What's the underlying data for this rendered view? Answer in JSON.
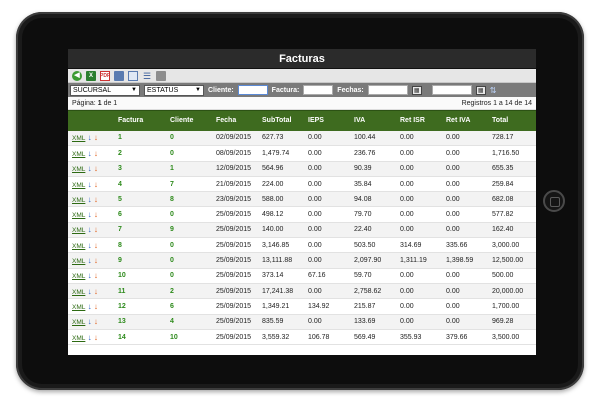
{
  "window": {
    "title": "Facturas"
  },
  "toolbar": {
    "icons": [
      "back-icon",
      "excel-export-icon",
      "pdf-export-icon",
      "print-preview-icon",
      "card-view-icon",
      "list-view-icon",
      "printer-icon"
    ]
  },
  "filters": {
    "sucursal": "SUCURSAL",
    "estatus": "ESTATUS",
    "cliente_label": "Cliente:",
    "cliente_value": "",
    "factura_label": "Factura:",
    "factura_value": "",
    "fechas_label": "Fechas:",
    "fecha_desde": "",
    "fecha_hasta": ""
  },
  "pager": {
    "page_label": "Página:",
    "page_current": "1",
    "page_of": "de 1",
    "records": "Registros 1 a 14 de 14"
  },
  "table": {
    "columns": [
      "",
      "Factura",
      "Cliente",
      "Fecha",
      "SubTotal",
      "IEPS",
      "IVA",
      "Ret ISR",
      "Ret IVA",
      "Total"
    ],
    "xml_label": "XML",
    "rows": [
      {
        "factura": "1",
        "cliente": "0",
        "fecha": "02/09/2015",
        "subtotal": "627.73",
        "ieps": "0.00",
        "iva": "100.44",
        "ret_isr": "0.00",
        "ret_iva": "0.00",
        "total": "728.17"
      },
      {
        "factura": "2",
        "cliente": "0",
        "fecha": "08/09/2015",
        "subtotal": "1,479.74",
        "ieps": "0.00",
        "iva": "236.76",
        "ret_isr": "0.00",
        "ret_iva": "0.00",
        "total": "1,716.50"
      },
      {
        "factura": "3",
        "cliente": "1",
        "fecha": "12/09/2015",
        "subtotal": "564.96",
        "ieps": "0.00",
        "iva": "90.39",
        "ret_isr": "0.00",
        "ret_iva": "0.00",
        "total": "655.35"
      },
      {
        "factura": "4",
        "cliente": "7",
        "fecha": "21/09/2015",
        "subtotal": "224.00",
        "ieps": "0.00",
        "iva": "35.84",
        "ret_isr": "0.00",
        "ret_iva": "0.00",
        "total": "259.84"
      },
      {
        "factura": "5",
        "cliente": "8",
        "fecha": "23/09/2015",
        "subtotal": "588.00",
        "ieps": "0.00",
        "iva": "94.08",
        "ret_isr": "0.00",
        "ret_iva": "0.00",
        "total": "682.08"
      },
      {
        "factura": "6",
        "cliente": "0",
        "fecha": "25/09/2015",
        "subtotal": "498.12",
        "ieps": "0.00",
        "iva": "79.70",
        "ret_isr": "0.00",
        "ret_iva": "0.00",
        "total": "577.82"
      },
      {
        "factura": "7",
        "cliente": "9",
        "fecha": "25/09/2015",
        "subtotal": "140.00",
        "ieps": "0.00",
        "iva": "22.40",
        "ret_isr": "0.00",
        "ret_iva": "0.00",
        "total": "162.40"
      },
      {
        "factura": "8",
        "cliente": "0",
        "fecha": "25/09/2015",
        "subtotal": "3,146.85",
        "ieps": "0.00",
        "iva": "503.50",
        "ret_isr": "314.69",
        "ret_iva": "335.66",
        "total": "3,000.00"
      },
      {
        "factura": "9",
        "cliente": "0",
        "fecha": "25/09/2015",
        "subtotal": "13,111.88",
        "ieps": "0.00",
        "iva": "2,097.90",
        "ret_isr": "1,311.19",
        "ret_iva": "1,398.59",
        "total": "12,500.00"
      },
      {
        "factura": "10",
        "cliente": "0",
        "fecha": "25/09/2015",
        "subtotal": "373.14",
        "ieps": "67.16",
        "iva": "59.70",
        "ret_isr": "0.00",
        "ret_iva": "0.00",
        "total": "500.00"
      },
      {
        "factura": "11",
        "cliente": "2",
        "fecha": "25/09/2015",
        "subtotal": "17,241.38",
        "ieps": "0.00",
        "iva": "2,758.62",
        "ret_isr": "0.00",
        "ret_iva": "0.00",
        "total": "20,000.00"
      },
      {
        "factura": "12",
        "cliente": "6",
        "fecha": "25/09/2015",
        "subtotal": "1,349.21",
        "ieps": "134.92",
        "iva": "215.87",
        "ret_isr": "0.00",
        "ret_iva": "0.00",
        "total": "1,700.00"
      },
      {
        "factura": "13",
        "cliente": "4",
        "fecha": "25/09/2015",
        "subtotal": "835.59",
        "ieps": "0.00",
        "iva": "133.69",
        "ret_isr": "0.00",
        "ret_iva": "0.00",
        "total": "969.28"
      },
      {
        "factura": "14",
        "cliente": "10",
        "fecha": "25/09/2015",
        "subtotal": "3,559.32",
        "ieps": "106.78",
        "iva": "569.49",
        "ret_isr": "355.93",
        "ret_iva": "379.66",
        "total": "3,500.00"
      }
    ]
  },
  "colors": {
    "header_green": "#3e6b1f",
    "number_green": "#2d8a1b",
    "download_arrow": "#2e63c9",
    "upload_arrow": "#e0621f"
  }
}
